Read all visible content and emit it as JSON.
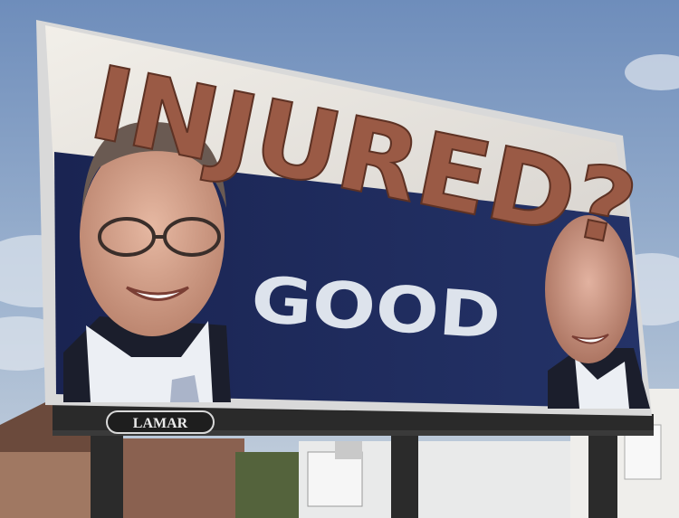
{
  "billboard": {
    "headline": "INJURED?",
    "tagline": "GOOD",
    "vendor": "LAMAR"
  },
  "colors": {
    "sky": "#8fa6c4",
    "board_panel": "#1f2d63",
    "board_upper": "#e6e2dc",
    "headline": "#9a5a45",
    "tagline": "#dde3ec",
    "frame": "#d9d9d9",
    "catwalk": "#2a2a2a"
  },
  "icons": [
    "lamar-logo"
  ]
}
